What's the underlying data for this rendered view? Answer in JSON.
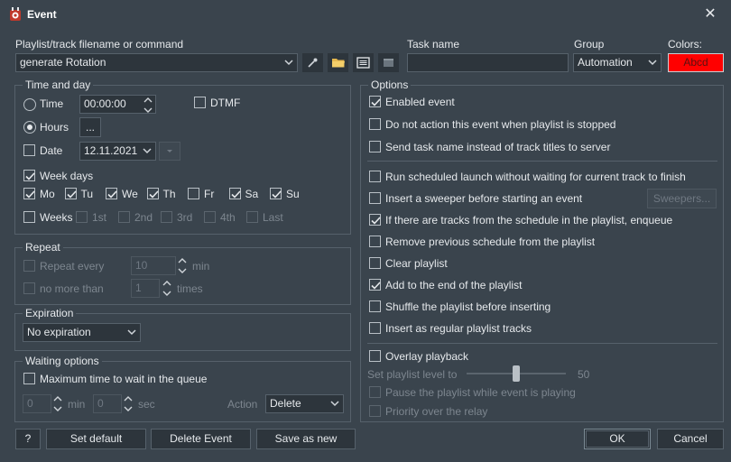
{
  "window": {
    "title": "Event"
  },
  "top": {
    "playlist_label": "Playlist/track filename or command",
    "playlist_value": "generate Rotation",
    "task_label": "Task name",
    "task_value": "",
    "group_label": "Group",
    "group_value": "Automation",
    "colors_label": "Colors:",
    "color_sample": "Abcd",
    "color_sample_bg": "#ff0000"
  },
  "time_and_day": {
    "title": "Time and day",
    "time_label": "Time",
    "time_value": "00:00:00",
    "dtmf_label": "DTMF",
    "hours_label": "Hours",
    "hours_button": "...",
    "date_label": "Date",
    "date_value": "12.11.2021",
    "week_days_label": "Week days",
    "days": [
      {
        "label": "Mo",
        "checked": true
      },
      {
        "label": "Tu",
        "checked": true
      },
      {
        "label": "We",
        "checked": true
      },
      {
        "label": "Th",
        "checked": true
      },
      {
        "label": "Fr",
        "checked": false
      },
      {
        "label": "Sa",
        "checked": true
      },
      {
        "label": "Su",
        "checked": true
      }
    ],
    "weeks_label": "Weeks",
    "weeks": [
      "1st",
      "2nd",
      "3rd",
      "4th",
      "Last"
    ]
  },
  "repeat": {
    "title": "Repeat",
    "repeat_every_label": "Repeat every",
    "repeat_every_value": "10",
    "repeat_every_unit": "min",
    "no_more_than_label": "no more than",
    "no_more_than_value": "1",
    "no_more_than_unit": "times"
  },
  "expiration": {
    "title": "Expiration",
    "value": "No expiration"
  },
  "waiting": {
    "title": "Waiting options",
    "max_time_label": "Maximum time to wait in the queue",
    "min_value": "0",
    "min_unit": "min",
    "sec_value": "0",
    "sec_unit": "sec",
    "action_label": "Action",
    "action_value": "Delete"
  },
  "options": {
    "title": "Options",
    "enabled_event": "Enabled event",
    "no_action_stopped": "Do not action this event when playlist is stopped",
    "send_task_name": "Send task name instead of track titles to server",
    "run_without_waiting": "Run scheduled launch without waiting for current track to finish",
    "insert_sweeper": "Insert a sweeper before starting an event",
    "sweepers_button": "Sweepers...",
    "enqueue": "If there are tracks from the schedule in the playlist, enqueue",
    "remove_previous": "Remove previous schedule from the playlist",
    "clear_playlist": "Clear playlist",
    "add_to_end": "Add to the end of the playlist",
    "shuffle": "Shuffle the playlist before inserting",
    "insert_regular": "Insert as regular playlist tracks",
    "overlay_playback": "Overlay playback",
    "set_level_label": "Set playlist level to",
    "level_value": "50",
    "level_fraction": 0.5,
    "pause_playlist": "Pause the playlist while event is playing",
    "priority_relay": "Priority over the relay"
  },
  "footer": {
    "help": "?",
    "set_default": "Set default",
    "delete_event": "Delete Event",
    "save_as_new": "Save as new",
    "ok": "OK",
    "cancel": "Cancel"
  }
}
